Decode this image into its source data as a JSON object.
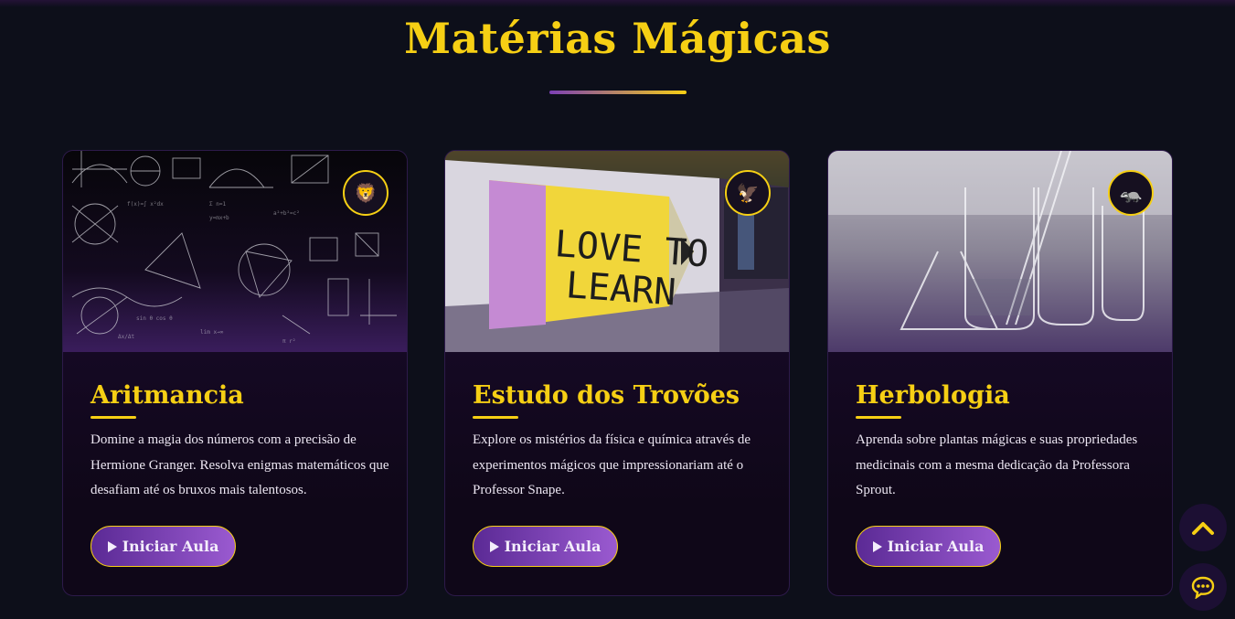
{
  "section": {
    "title": "Matérias Mágicas"
  },
  "cards": [
    {
      "title": "Aritmancia",
      "description": "Domine a magia dos números com a precisão de Hermione Granger. Resolva enigmas matemáticos que desafiam até os bruxos mais talentosos.",
      "button_label": "Iniciar Aula",
      "badge_icon": "lion-icon",
      "image": "math-formulas-chalkboard"
    },
    {
      "title": "Estudo dos Trovões",
      "description": "Explore os mistérios da física e química através de experimentos mágicos que impressionariam até o Professor Snape.",
      "button_label": "Iniciar Aula",
      "badge_icon": "eagle-icon",
      "image": "love-to-learn-pencil-sign",
      "image_text_line1": "LOVE TO",
      "image_text_line2": "LEARN"
    },
    {
      "title": "Herbologia",
      "description": "Aprenda sobre plantas mágicas e suas propriedades medicinais com a mesma dedicação da Professora Sprout.",
      "button_label": "Iniciar Aula",
      "badge_icon": "badger-icon",
      "image": "laboratory-glassware"
    }
  ],
  "floating": {
    "scroll_top_icon": "chevron-up-icon",
    "chat_icon": "chat-bubble-icon"
  },
  "colors": {
    "accent": "#f6cf14",
    "purple": "#7b3fb5",
    "background": "#0d0f1a"
  }
}
